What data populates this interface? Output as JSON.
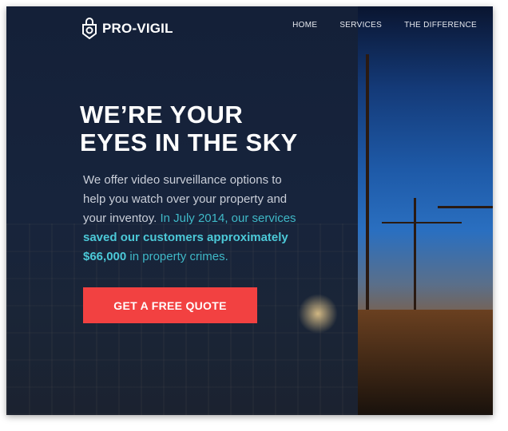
{
  "brand": {
    "name": "PRO-VIGIL",
    "icon": "lock-camera-icon"
  },
  "nav": [
    {
      "label": "HOME"
    },
    {
      "label": "SERVICES"
    },
    {
      "label": "THE DIFFERENCE"
    }
  ],
  "hero": {
    "title_line1": "WE’RE YOUR",
    "title_line2": "EYES IN THE SKY",
    "text_plain": "We offer video surveillance options to help you watch over your property and your inventoy.",
    "text_highlight": " In July 2014, our services ",
    "text_bold1": "saved our customers approximately",
    "text_bold2": "$66,000",
    "text_end": " in property crimes.",
    "cta_label": "GET A FREE QUOTE"
  },
  "colors": {
    "accent": "#4cc9d8",
    "cta": "#f24141",
    "background": "#14213a"
  }
}
